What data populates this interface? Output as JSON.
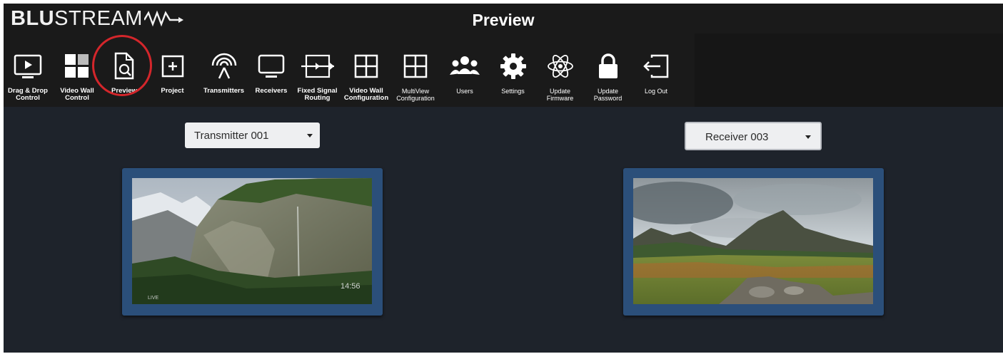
{
  "header": {
    "brand_bold": "BLU",
    "brand_light": "STREAM",
    "title": "Preview"
  },
  "toolbar": {
    "items": [
      {
        "label": "Drag & Drop Control",
        "icon": "play-screen-icon"
      },
      {
        "label": "Video Wall Control",
        "icon": "video-wall-grid-icon"
      },
      {
        "label": "Preview",
        "icon": "document-search-icon",
        "active": true
      },
      {
        "label": "Project",
        "icon": "plus-square-icon"
      },
      {
        "label": "Transmitters",
        "icon": "broadcast-icon"
      },
      {
        "label": "Receivers",
        "icon": "monitor-icon"
      },
      {
        "label": "Fixed Signal Routing",
        "icon": "routing-icon"
      },
      {
        "label": "Video Wall Configuration",
        "icon": "grid-2x2-icon"
      },
      {
        "label": "MultiView Configuration",
        "icon": "grid-2x2-icon"
      },
      {
        "label": "Users",
        "icon": "users-icon"
      },
      {
        "label": "Settings",
        "icon": "gear-icon"
      },
      {
        "label": "Update Firmware",
        "icon": "atom-icon"
      },
      {
        "label": "Update Password",
        "icon": "lock-icon"
      },
      {
        "label": "Log Out",
        "icon": "logout-icon"
      }
    ],
    "accent_color": "#3a6fc4",
    "highlight_color": "#d4262b"
  },
  "main": {
    "transmitter_select": {
      "value": "Transmitter 001"
    },
    "receiver_select": {
      "value": "Receiver 003"
    },
    "transmitter_preview": {
      "overlay_text": "14:56",
      "overlay_corner": "LIVE"
    },
    "receiver_preview": {}
  }
}
